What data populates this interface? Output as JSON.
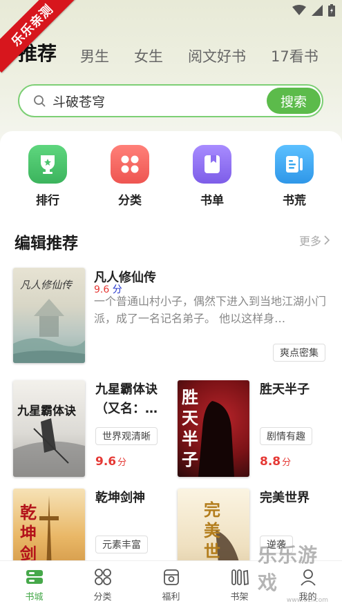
{
  "watermark_top": "乐乐亲测",
  "top_tabs": [
    {
      "label": "推荐",
      "active": true
    },
    {
      "label": "男生",
      "active": false
    },
    {
      "label": "女生",
      "active": false
    },
    {
      "label": "阅文好书",
      "active": false
    },
    {
      "label": "17看书",
      "active": false
    }
  ],
  "search": {
    "value": "斗破苍穹",
    "button_label": "搜索"
  },
  "quick_nav": [
    {
      "label": "排行",
      "icon": "trophy-icon",
      "color": "#4cc46e"
    },
    {
      "label": "分类",
      "icon": "grid-icon",
      "color": "#f0615c"
    },
    {
      "label": "书单",
      "icon": "booklist-icon",
      "color": "#8d6ff2"
    },
    {
      "label": "书荒",
      "icon": "book-open-icon",
      "color": "#38a8ef"
    }
  ],
  "section": {
    "title": "编辑推荐",
    "more": "更多"
  },
  "featured": {
    "title": "凡人修仙传",
    "score": "9.6",
    "score_unit": "分",
    "description": "一个普通山村小子，偶然下进入到当地江湖小门派，成了一名记名弟子。 他以这样身…",
    "tag": "爽点密集",
    "cover_text": "凡人修仙传"
  },
  "books": [
    {
      "title": "九星霸体诀（又名：…",
      "tag": "世界观清晰",
      "score": "9.6",
      "score_unit": "分",
      "cover_text": "九星霸体诀"
    },
    {
      "title": "胜天半子",
      "tag": "剧情有趣",
      "score": "8.8",
      "score_unit": "分",
      "cover_text": "胜天半子"
    },
    {
      "title": "乾坤剑神",
      "tag": "元素丰富",
      "score": "",
      "score_unit": "",
      "cover_text": "乾坤剑神"
    },
    {
      "title": "完美世界",
      "tag": "逆袭",
      "score": "",
      "score_unit": "",
      "cover_text": "完美世界"
    }
  ],
  "bottom_nav": [
    {
      "label": "书城",
      "icon": "bookstore-icon",
      "active": true
    },
    {
      "label": "分类",
      "icon": "category-icon",
      "active": false
    },
    {
      "label": "福利",
      "icon": "gift-icon",
      "active": false
    },
    {
      "label": "书架",
      "icon": "bookshelf-icon",
      "active": false
    },
    {
      "label": "我的",
      "icon": "profile-icon",
      "active": false
    }
  ],
  "watermark_bottom": {
    "text": "乐乐游戏",
    "url": "www.61l.com"
  },
  "colors": {
    "accent": "#5cbb4b",
    "score": "#e53935",
    "ribbon": "#d7161d"
  }
}
